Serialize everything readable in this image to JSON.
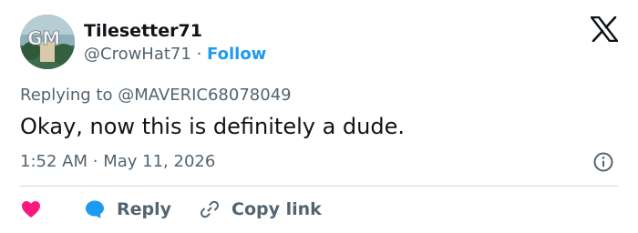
{
  "author": {
    "name": "Tilesetter71",
    "handle": "@CrowHat71",
    "separator": "·",
    "follow_label": "Follow",
    "avatar_text": "GM"
  },
  "reply_context": {
    "prefix": "Replying to",
    "mention": "@MAVERIC68078049"
  },
  "tweet": {
    "text": "Okay, now this is definitely a dude.",
    "time": "1:52 AM",
    "separator": "·",
    "date": "May 11, 2026"
  },
  "actions": {
    "reply_label": "Reply",
    "copy_link_label": "Copy link"
  },
  "icons": {
    "logo": "x-logo-icon",
    "info": "info-icon",
    "like": "heart-icon",
    "reply": "chat-bubble-icon",
    "copy": "link-icon"
  },
  "colors": {
    "accent": "#1d9bf0",
    "like": "#f91880",
    "secondary_text": "#536471",
    "primary_text": "#0f1419"
  }
}
